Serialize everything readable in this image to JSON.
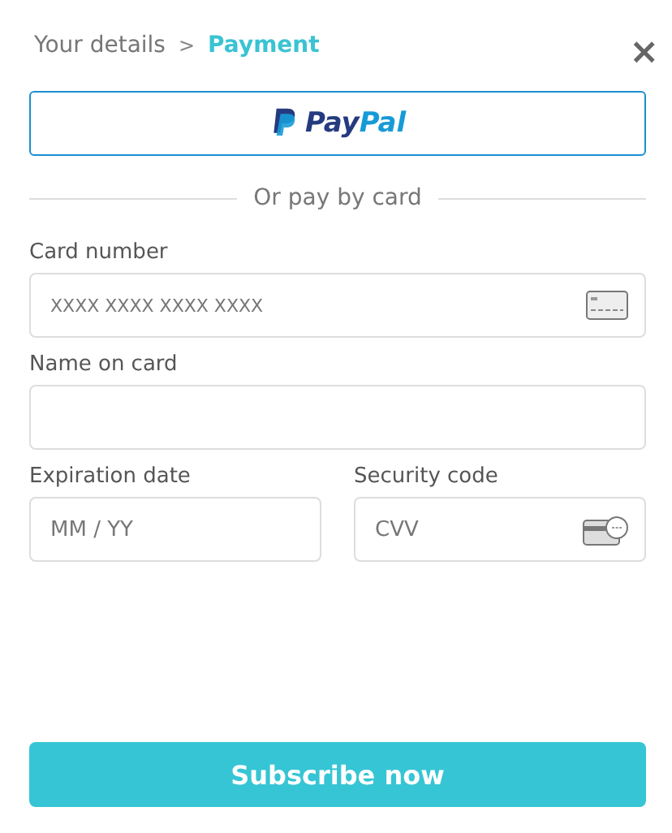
{
  "breadcrumb": [
    {
      "label": "Your details",
      "selected": false
    },
    {
      "label": "Payment",
      "selected": true
    }
  ],
  "breadcrumb_separator": ">",
  "close": "×",
  "paypal_button": {
    "parts": [
      "Pay",
      "Pal"
    ]
  },
  "divider": "Or pay by card",
  "fields": [
    {
      "label": "Card number",
      "placeholder": "XXXX XXXX XXXX XXXX",
      "kind": "card",
      "half": false
    },
    {
      "label": "Name on card",
      "kind": "plain",
      "half": false
    },
    {
      "label": "Expiration date",
      "placeholder": "MM / YY",
      "kind": "plain",
      "half": true
    },
    {
      "label": "Security code",
      "placeholder": "CVV",
      "kind": "cvv",
      "half": true
    }
  ],
  "submit": "Subscribe now"
}
